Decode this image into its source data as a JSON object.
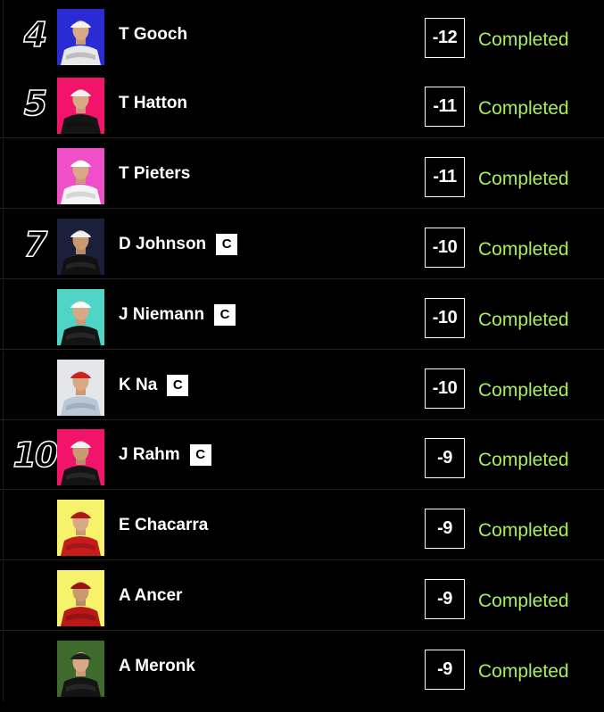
{
  "rows": [
    {
      "pos": "4",
      "name": "T Gooch",
      "captain": "",
      "score": "-12",
      "status": "Completed",
      "bg": "#2b2bd6",
      "shirt": "#e8e8e8",
      "cap": "#f2f2f2"
    },
    {
      "pos": "5",
      "name": "T Hatton",
      "captain": "",
      "score": "-11",
      "status": "Completed",
      "bg": "#f2146a",
      "shirt": "#151515",
      "cap": "#f0f0f0"
    },
    {
      "pos": "",
      "name": "T Pieters",
      "captain": "",
      "score": "-11",
      "status": "Completed",
      "bg": "#ef4fc9",
      "shirt": "#f4f4f4",
      "cap": "#ffffff"
    },
    {
      "pos": "7",
      "name": "D Johnson",
      "captain": "C",
      "score": "-10",
      "status": "Completed",
      "bg": "#1b1f3a",
      "shirt": "#111111",
      "cap": "#f0f0f0"
    },
    {
      "pos": "",
      "name": "J Niemann",
      "captain": "C",
      "score": "-10",
      "status": "Completed",
      "bg": "#4fd5c6",
      "shirt": "#141414",
      "cap": "#ffffff"
    },
    {
      "pos": "",
      "name": "K Na",
      "captain": "C",
      "score": "-10",
      "status": "Completed",
      "bg": "#e4e6ea",
      "shirt": "#b8c8d8",
      "cap": "#c6261e"
    },
    {
      "pos": "10",
      "name": "J Rahm",
      "captain": "C",
      "score": "-9",
      "status": "Completed",
      "bg": "#f2146a",
      "shirt": "#141414",
      "cap": "#f3f3f3"
    },
    {
      "pos": "",
      "name": "E Chacarra",
      "captain": "",
      "score": "-9",
      "status": "Completed",
      "bg": "#f6f36a",
      "shirt": "#c81c1c",
      "cap": "#b01818"
    },
    {
      "pos": "",
      "name": "A Ancer",
      "captain": "",
      "score": "-9",
      "status": "Completed",
      "bg": "#f6f36a",
      "shirt": "#b81818",
      "cap": "#9a1212"
    },
    {
      "pos": "",
      "name": "A Meronk",
      "captain": "",
      "score": "-9",
      "status": "Completed",
      "bg": "#3f6a2e",
      "shirt": "#141414",
      "cap": "#1e1e1e"
    }
  ]
}
